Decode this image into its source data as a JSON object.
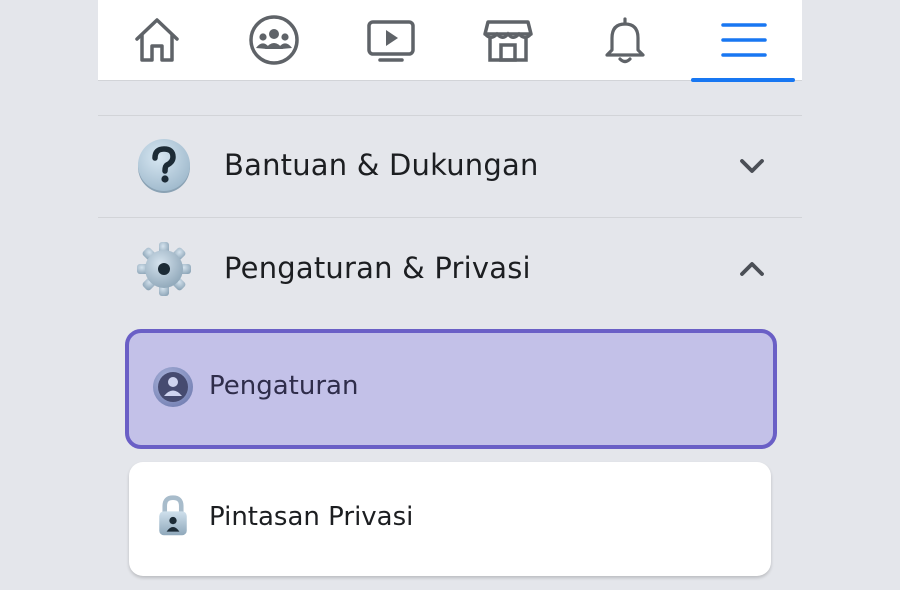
{
  "topnav": {
    "items": [
      {
        "name": "home",
        "icon": "home-icon"
      },
      {
        "name": "groups",
        "icon": "groups-icon"
      },
      {
        "name": "watch",
        "icon": "video-play-icon"
      },
      {
        "name": "marketplace",
        "icon": "marketplace-store-icon"
      },
      {
        "name": "notifications",
        "icon": "bell-icon"
      },
      {
        "name": "menu",
        "icon": "hamburger-menu-icon",
        "active": true
      }
    ],
    "active_color": "#1877f2"
  },
  "sections": {
    "help": {
      "label": "Bantuan & Dukungan",
      "icon": "question-mark-icon",
      "expanded": false
    },
    "settings": {
      "label": "Pengaturan & Privasi",
      "icon": "gear-icon",
      "expanded": true
    }
  },
  "submenu": {
    "settings_item": {
      "label": "Pengaturan",
      "icon": "profile-icon",
      "highlighted": true
    },
    "privacy_shortcuts": {
      "label": "Pintasan Privasi",
      "icon": "lock-icon"
    }
  },
  "colors": {
    "highlight_fill": "#c3c1e8",
    "highlight_border": "#6a5fc6",
    "background": "#e4e6eb"
  }
}
